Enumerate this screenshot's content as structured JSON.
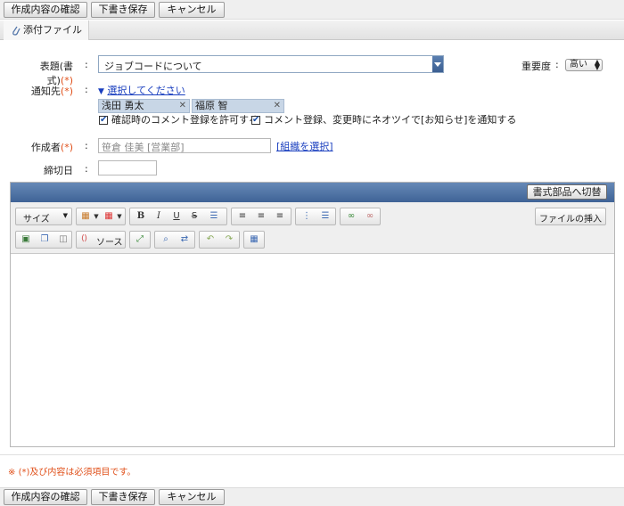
{
  "top_buttons": {
    "confirm": "作成内容の確認",
    "draft": "下書き保存",
    "cancel": "キャンセル"
  },
  "bottom_buttons": {
    "confirm": "作成内容の確認",
    "draft": "下書き保存",
    "cancel": "キャンセル"
  },
  "tab": {
    "label": "添付ファイル"
  },
  "form": {
    "subject": {
      "label": "表題(書式)",
      "req": "(*)",
      "colon": ":",
      "value": "ジョブコードについて"
    },
    "importance": {
      "label": "重要度",
      "colon": ":",
      "value": "高い"
    },
    "recipients": {
      "label": "通知先",
      "req": "(*)",
      "colon": ":",
      "select_link": "選択してください",
      "chips": [
        "浅田 勇太",
        "福原 智"
      ],
      "options": [
        "確認時のコメント登録を許可する",
        "コメント登録、変更時にネオツイで[お知らせ]を通知する"
      ]
    },
    "author": {
      "label": "作成者",
      "req": "(*)",
      "colon": ":",
      "value": "笹倉 佳美 [営業部]",
      "org_link": "[組織を選択]"
    },
    "deadline": {
      "label": "締切日",
      "colon": ":",
      "value": ""
    }
  },
  "editor": {
    "switch_button": "書式部品へ切替",
    "size_label": "サイズ",
    "source_label": "ソース",
    "insert_file": "ファイルの挿入"
  },
  "footer": {
    "note": "(*)及び内容は必須項目です。",
    "mark": "※"
  }
}
